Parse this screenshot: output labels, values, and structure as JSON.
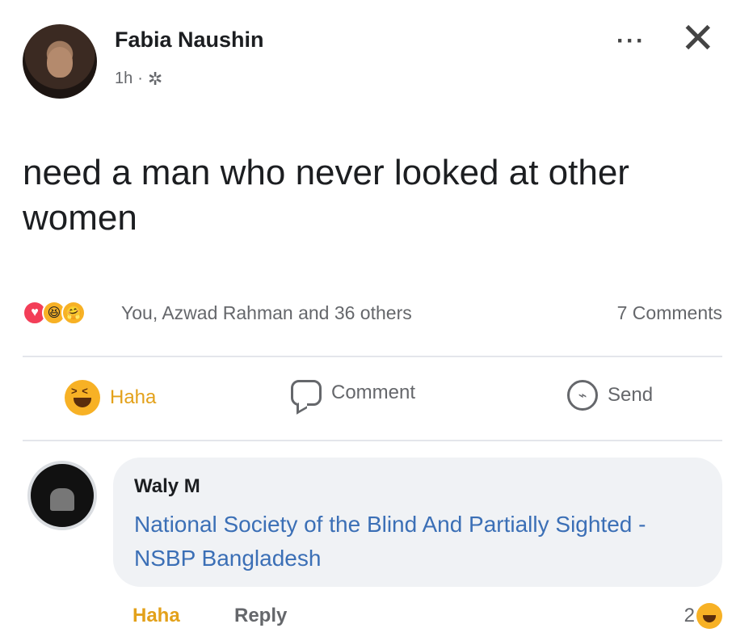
{
  "post": {
    "author": "Fabia Naushin",
    "time": "1h",
    "separator": "·",
    "text": "need a man who never looked at other women",
    "more_icon": "more-icon",
    "close_icon": "close-icon"
  },
  "reactions": {
    "summary": "You, Azwad Rahman and 36 others",
    "comments": "7 Comments",
    "types": [
      "love",
      "haha",
      "care"
    ]
  },
  "actions": {
    "haha": "Haha",
    "comment": "Comment",
    "send": "Send"
  },
  "comment": {
    "author": "Waly M",
    "text": "National Society of the Blind And Partially Sighted - NSBP Bangladesh",
    "haha": "Haha",
    "reply": "Reply",
    "reaction_count": "2"
  },
  "colors": {
    "haha_accent": "#e3a11a",
    "link_blue": "#3b6fb6",
    "muted_text": "#65676b"
  }
}
